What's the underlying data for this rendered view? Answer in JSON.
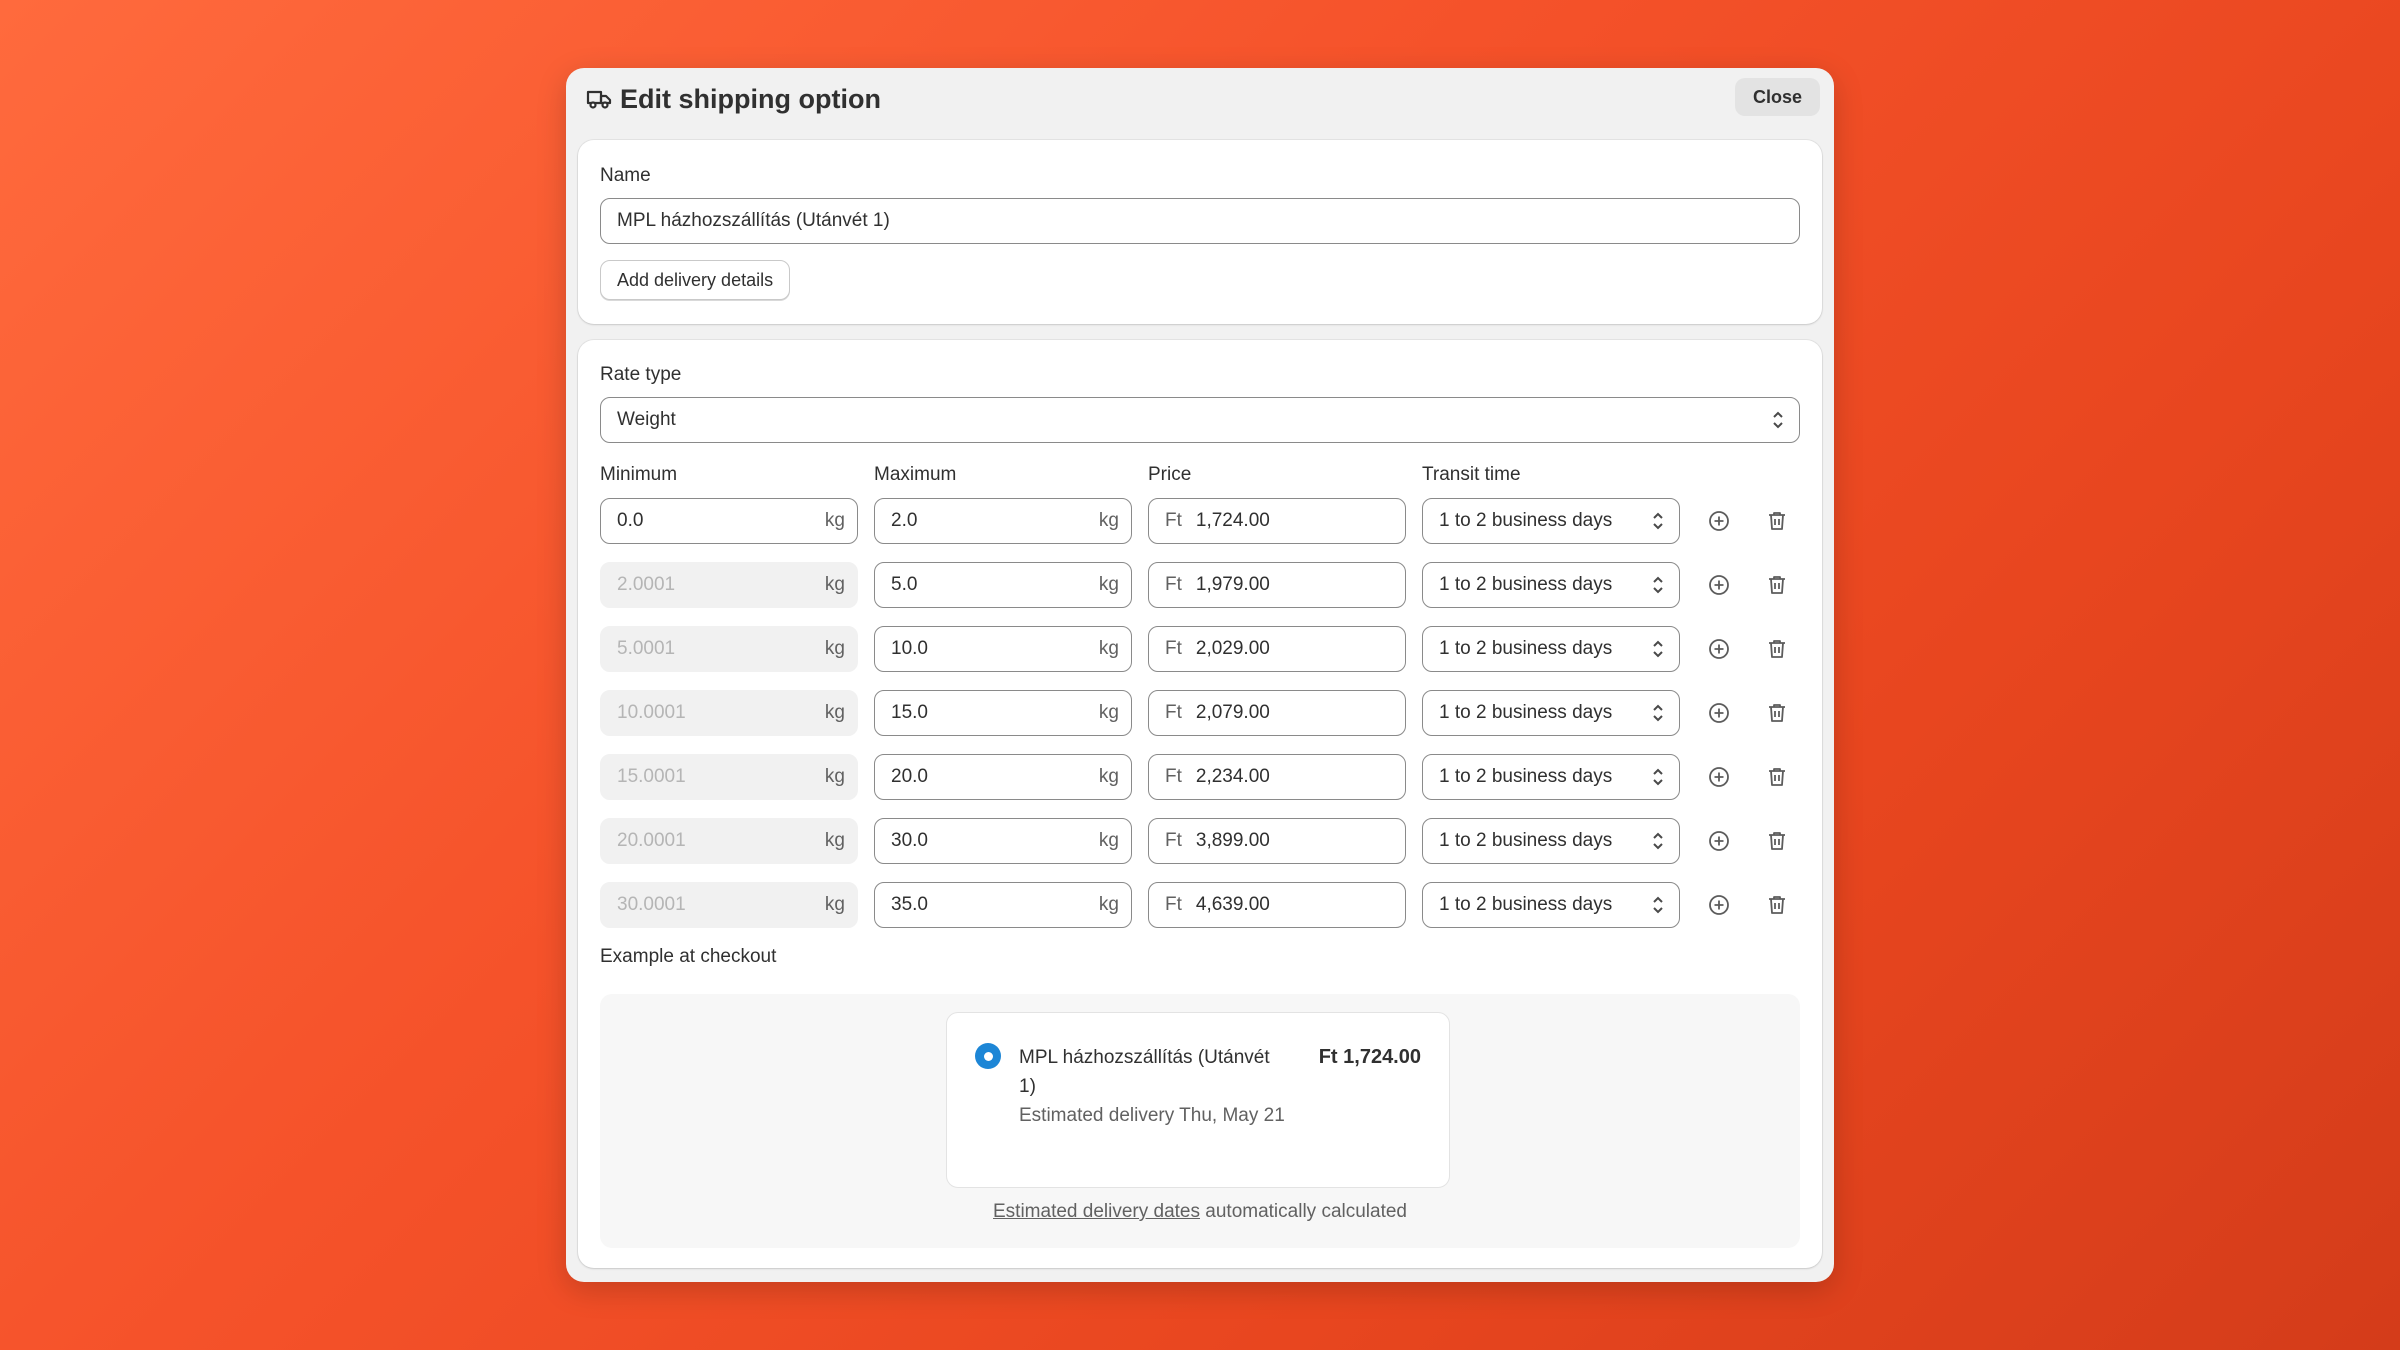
{
  "modal": {
    "title": "Edit shipping option",
    "close_label": "Close",
    "icon": "truck-icon"
  },
  "name_section": {
    "label": "Name",
    "value": "MPL házhozszállítás (Utánvét 1)",
    "add_details_label": "Add delivery details"
  },
  "rate": {
    "label": "Rate type",
    "value": "Weight",
    "headers": {
      "min": "Minimum",
      "max": "Maximum",
      "price": "Price",
      "transit": "Transit time"
    },
    "unit": "kg",
    "currency": "Ft",
    "rows": [
      {
        "min": "0.0",
        "max": "2.0",
        "price": "1,724.00",
        "transit": "1 to 2 business days"
      },
      {
        "min": "2.0001",
        "max": "5.0",
        "price": "1,979.00",
        "transit": "1 to 2 business days"
      },
      {
        "min": "5.0001",
        "max": "10.0",
        "price": "2,029.00",
        "transit": "1 to 2 business days"
      },
      {
        "min": "10.0001",
        "max": "15.0",
        "price": "2,079.00",
        "transit": "1 to 2 business days"
      },
      {
        "min": "15.0001",
        "max": "20.0",
        "price": "2,234.00",
        "transit": "1 to 2 business days"
      },
      {
        "min": "20.0001",
        "max": "30.0",
        "price": "3,899.00",
        "transit": "1 to 2 business days"
      },
      {
        "min": "30.0001",
        "max": "35.0",
        "price": "4,639.00",
        "transit": "1 to 2 business days"
      }
    ]
  },
  "example": {
    "label": "Example at checkout",
    "name": "MPL házhozszállítás (Utánvét 1)",
    "estimate": "Estimated delivery Thu, May 21",
    "price": "Ft 1,724.00",
    "note_link": "Estimated delivery dates",
    "note_rest": " automatically calculated"
  },
  "colors": {
    "accent": "#1d86d6",
    "background": "#f5522a"
  }
}
